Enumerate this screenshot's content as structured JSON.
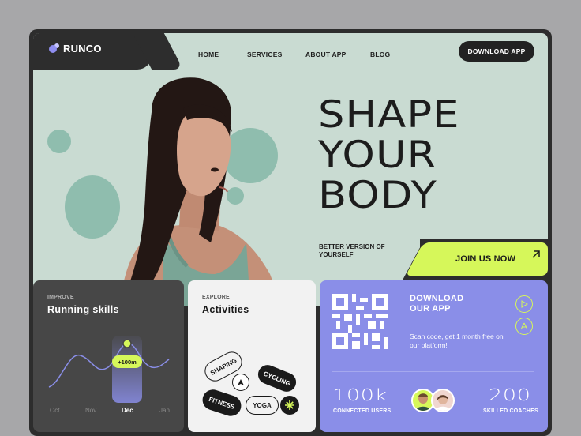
{
  "brand": {
    "name": "RUNCO"
  },
  "nav": [
    {
      "label": "HOME"
    },
    {
      "label": "SERVICES"
    },
    {
      "label": "ABOUT APP"
    },
    {
      "label": "BLOG"
    }
  ],
  "header": {
    "download_label": "DOWNLOAD APP"
  },
  "hero": {
    "headline": [
      "SHAPE",
      "YOUR",
      "BODY"
    ],
    "tagline": "BETTER VERSION OF YOURSELF",
    "cta_label": "JOIN US NOW"
  },
  "skills": {
    "eyebrow": "IMPROVE",
    "title": "Running skills",
    "badge": "+100m",
    "months": [
      "Oct",
      "Nov",
      "Dec",
      "Jan"
    ],
    "active_month": "Dec"
  },
  "activities": {
    "eyebrow": "EXPLORE",
    "title": "Activities",
    "tags": [
      "SHAPING",
      "CYCLING",
      "FITNESS",
      "YOGA"
    ]
  },
  "app": {
    "title_line1": "DOWNLOAD",
    "title_line2": "OUR APP",
    "text": "Scan code, get 1 month free on our platform!",
    "stats": [
      {
        "value": "100k",
        "label": "CONNECTED USERS"
      },
      {
        "value": "200",
        "label": "SKILLED COACHES"
      }
    ]
  },
  "colors": {
    "accent_lime": "#d6f75a",
    "hero_mint": "#c9dbd2",
    "app_violet": "#8a8ee8",
    "dark": "#2d2d2d"
  },
  "icons": [
    "play-store-icon",
    "app-store-icon",
    "arrow-up-right-icon",
    "star-icon",
    "triangle-icon"
  ]
}
